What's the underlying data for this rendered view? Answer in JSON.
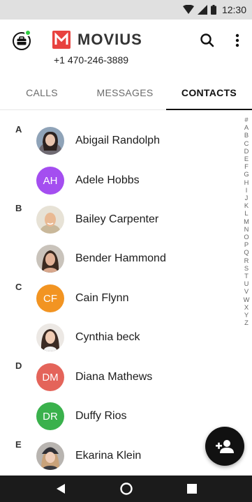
{
  "status_bar": {
    "time": "12:30"
  },
  "header": {
    "brand_name": "MOVIUS",
    "phone_number": "+1 470-246-3889",
    "brand_color": "#e8423f",
    "presence_color": "#2ecc40"
  },
  "tabs": [
    {
      "label": "CALLS",
      "active": false
    },
    {
      "label": "MESSAGES",
      "active": false
    },
    {
      "label": "CONTACTS",
      "active": true
    }
  ],
  "sections": [
    {
      "letter": "A"
    },
    {
      "letter": "B"
    },
    {
      "letter": "C"
    },
    {
      "letter": "D"
    },
    {
      "letter": "E"
    }
  ],
  "contacts": [
    {
      "name": "Abigail Randolph",
      "avatar": "photo",
      "section": "A"
    },
    {
      "name": "Adele Hobbs",
      "avatar": "initials",
      "initials": "AH",
      "color": "#a44ef0",
      "section": "A"
    },
    {
      "name": "Bailey Carpenter",
      "avatar": "photo",
      "section": "B"
    },
    {
      "name": "Bender Hammond",
      "avatar": "photo",
      "section": "B"
    },
    {
      "name": "Cain Flynn",
      "avatar": "initials",
      "initials": "CF",
      "color": "#f29422",
      "section": "C"
    },
    {
      "name": "Cynthia beck",
      "avatar": "photo",
      "section": "C"
    },
    {
      "name": "Diana Mathews",
      "avatar": "initials",
      "initials": "DM",
      "color": "#e4645a",
      "section": "D"
    },
    {
      "name": "Duffy Rios",
      "avatar": "initials",
      "initials": "DR",
      "color": "#3ab14c",
      "section": "D"
    },
    {
      "name": "Ekarina Klein",
      "avatar": "photo",
      "section": "E"
    }
  ],
  "alphabet_index": [
    "#",
    "A",
    "B",
    "C",
    "D",
    "E",
    "F",
    "G",
    "H",
    "I",
    "J",
    "K",
    "L",
    "M",
    "N",
    "O",
    "P",
    "Q",
    "R",
    "S",
    "T",
    "U",
    "V",
    "W",
    "X",
    "Y",
    "Z"
  ],
  "fab": {
    "icon": "add-contact-icon"
  }
}
